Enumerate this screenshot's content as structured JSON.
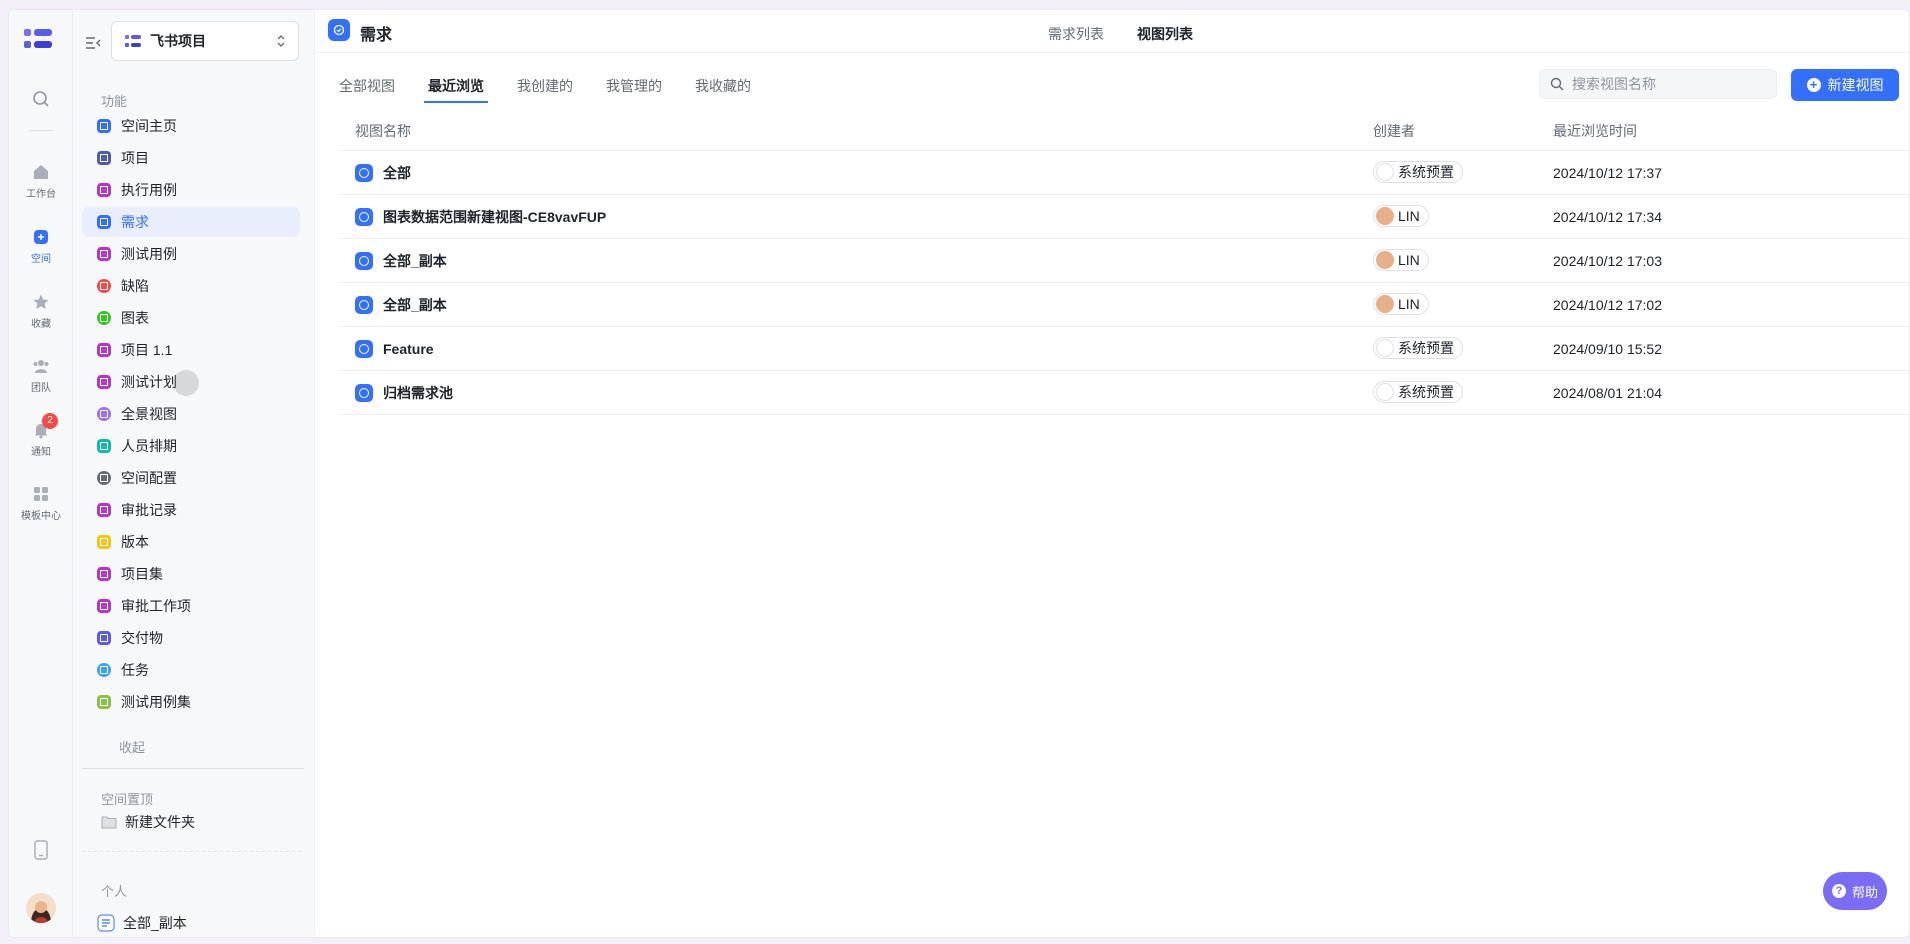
{
  "rail": {
    "items": [
      {
        "label": "工作台",
        "icon": "home-icon",
        "active": false
      },
      {
        "label": "空间",
        "icon": "space-icon",
        "active": true
      },
      {
        "label": "收藏",
        "icon": "star-icon",
        "active": false
      },
      {
        "label": "团队",
        "icon": "team-icon",
        "active": false
      },
      {
        "label": "通知",
        "icon": "bell-icon",
        "active": false,
        "badge": "2"
      },
      {
        "label": "模板中心",
        "icon": "template-icon",
        "active": false
      }
    ]
  },
  "sidebar": {
    "space_name": "飞书项目",
    "section_features": "功能",
    "items": [
      {
        "label": "空间主页",
        "color": "#3370ff",
        "active": false
      },
      {
        "label": "项目",
        "color": "#4e5ba6",
        "active": false
      },
      {
        "label": "执行用例",
        "color": "#b03ac4",
        "active": false
      },
      {
        "label": "需求",
        "color": "#3370ff",
        "active": true
      },
      {
        "label": "测试用例",
        "color": "#b03ac4",
        "active": false
      },
      {
        "label": "缺陷",
        "color": "#f54a45",
        "active": false
      },
      {
        "label": "图表",
        "color": "#34c724",
        "active": false
      },
      {
        "label": "项目 1.1",
        "color": "#b03ac4",
        "active": false
      },
      {
        "label": "测试计划",
        "color": "#b03ac4",
        "active": false
      },
      {
        "label": "全景视图",
        "color": "#9f6ff1",
        "active": false
      },
      {
        "label": "人员排期",
        "color": "#14b8a6",
        "active": false
      },
      {
        "label": "空间配置",
        "color": "#646a73",
        "active": false
      },
      {
        "label": "审批记录",
        "color": "#b03ac4",
        "active": false
      },
      {
        "label": "版本",
        "color": "#f5c518",
        "active": false
      },
      {
        "label": "项目集",
        "color": "#b03ac4",
        "active": false
      },
      {
        "label": "审批工作项",
        "color": "#b03ac4",
        "active": false
      },
      {
        "label": "交付物",
        "color": "#5b5ce6",
        "active": false
      },
      {
        "label": "任务",
        "color": "#3aa3f8",
        "active": false
      },
      {
        "label": "测试用例集",
        "color": "#8bc34a",
        "active": false
      }
    ],
    "collapse_label": "收起",
    "section_pinned": "空间置顶",
    "new_folder": "新建文件夹",
    "section_personal": "个人",
    "personal_item": "全部_副本"
  },
  "topbar": {
    "title": "需求",
    "tabs": [
      "需求列表",
      "视图列表"
    ],
    "active_tab": "视图列表"
  },
  "subtabs": [
    "全部视图",
    "最近浏览",
    "我创建的",
    "我管理的",
    "我收藏的"
  ],
  "active_subtab": "最近浏览",
  "search": {
    "placeholder": "搜索视图名称"
  },
  "new_view_label": "新建视图",
  "table": {
    "headers": [
      "视图名称",
      "创建者",
      "最近浏览时间"
    ],
    "rows": [
      {
        "name": "全部",
        "creator": "系统预置",
        "time": "2024/10/12 17:37",
        "person": false
      },
      {
        "name": "图表数据范围新建视图-CE8vavFUP",
        "creator": "LIN",
        "time": "2024/10/12 17:34",
        "person": true
      },
      {
        "name": "全部_副本",
        "creator": "LIN",
        "time": "2024/10/12 17:03",
        "person": true
      },
      {
        "name": "全部_副本",
        "creator": "LIN",
        "time": "2024/10/12 17:02",
        "person": true
      },
      {
        "name": "Feature",
        "creator": "系统预置",
        "time": "2024/09/10 15:52",
        "person": false
      },
      {
        "name": "归档需求池",
        "creator": "系统预置",
        "time": "2024/08/01 21:04",
        "person": false
      }
    ]
  },
  "help_label": "帮助"
}
